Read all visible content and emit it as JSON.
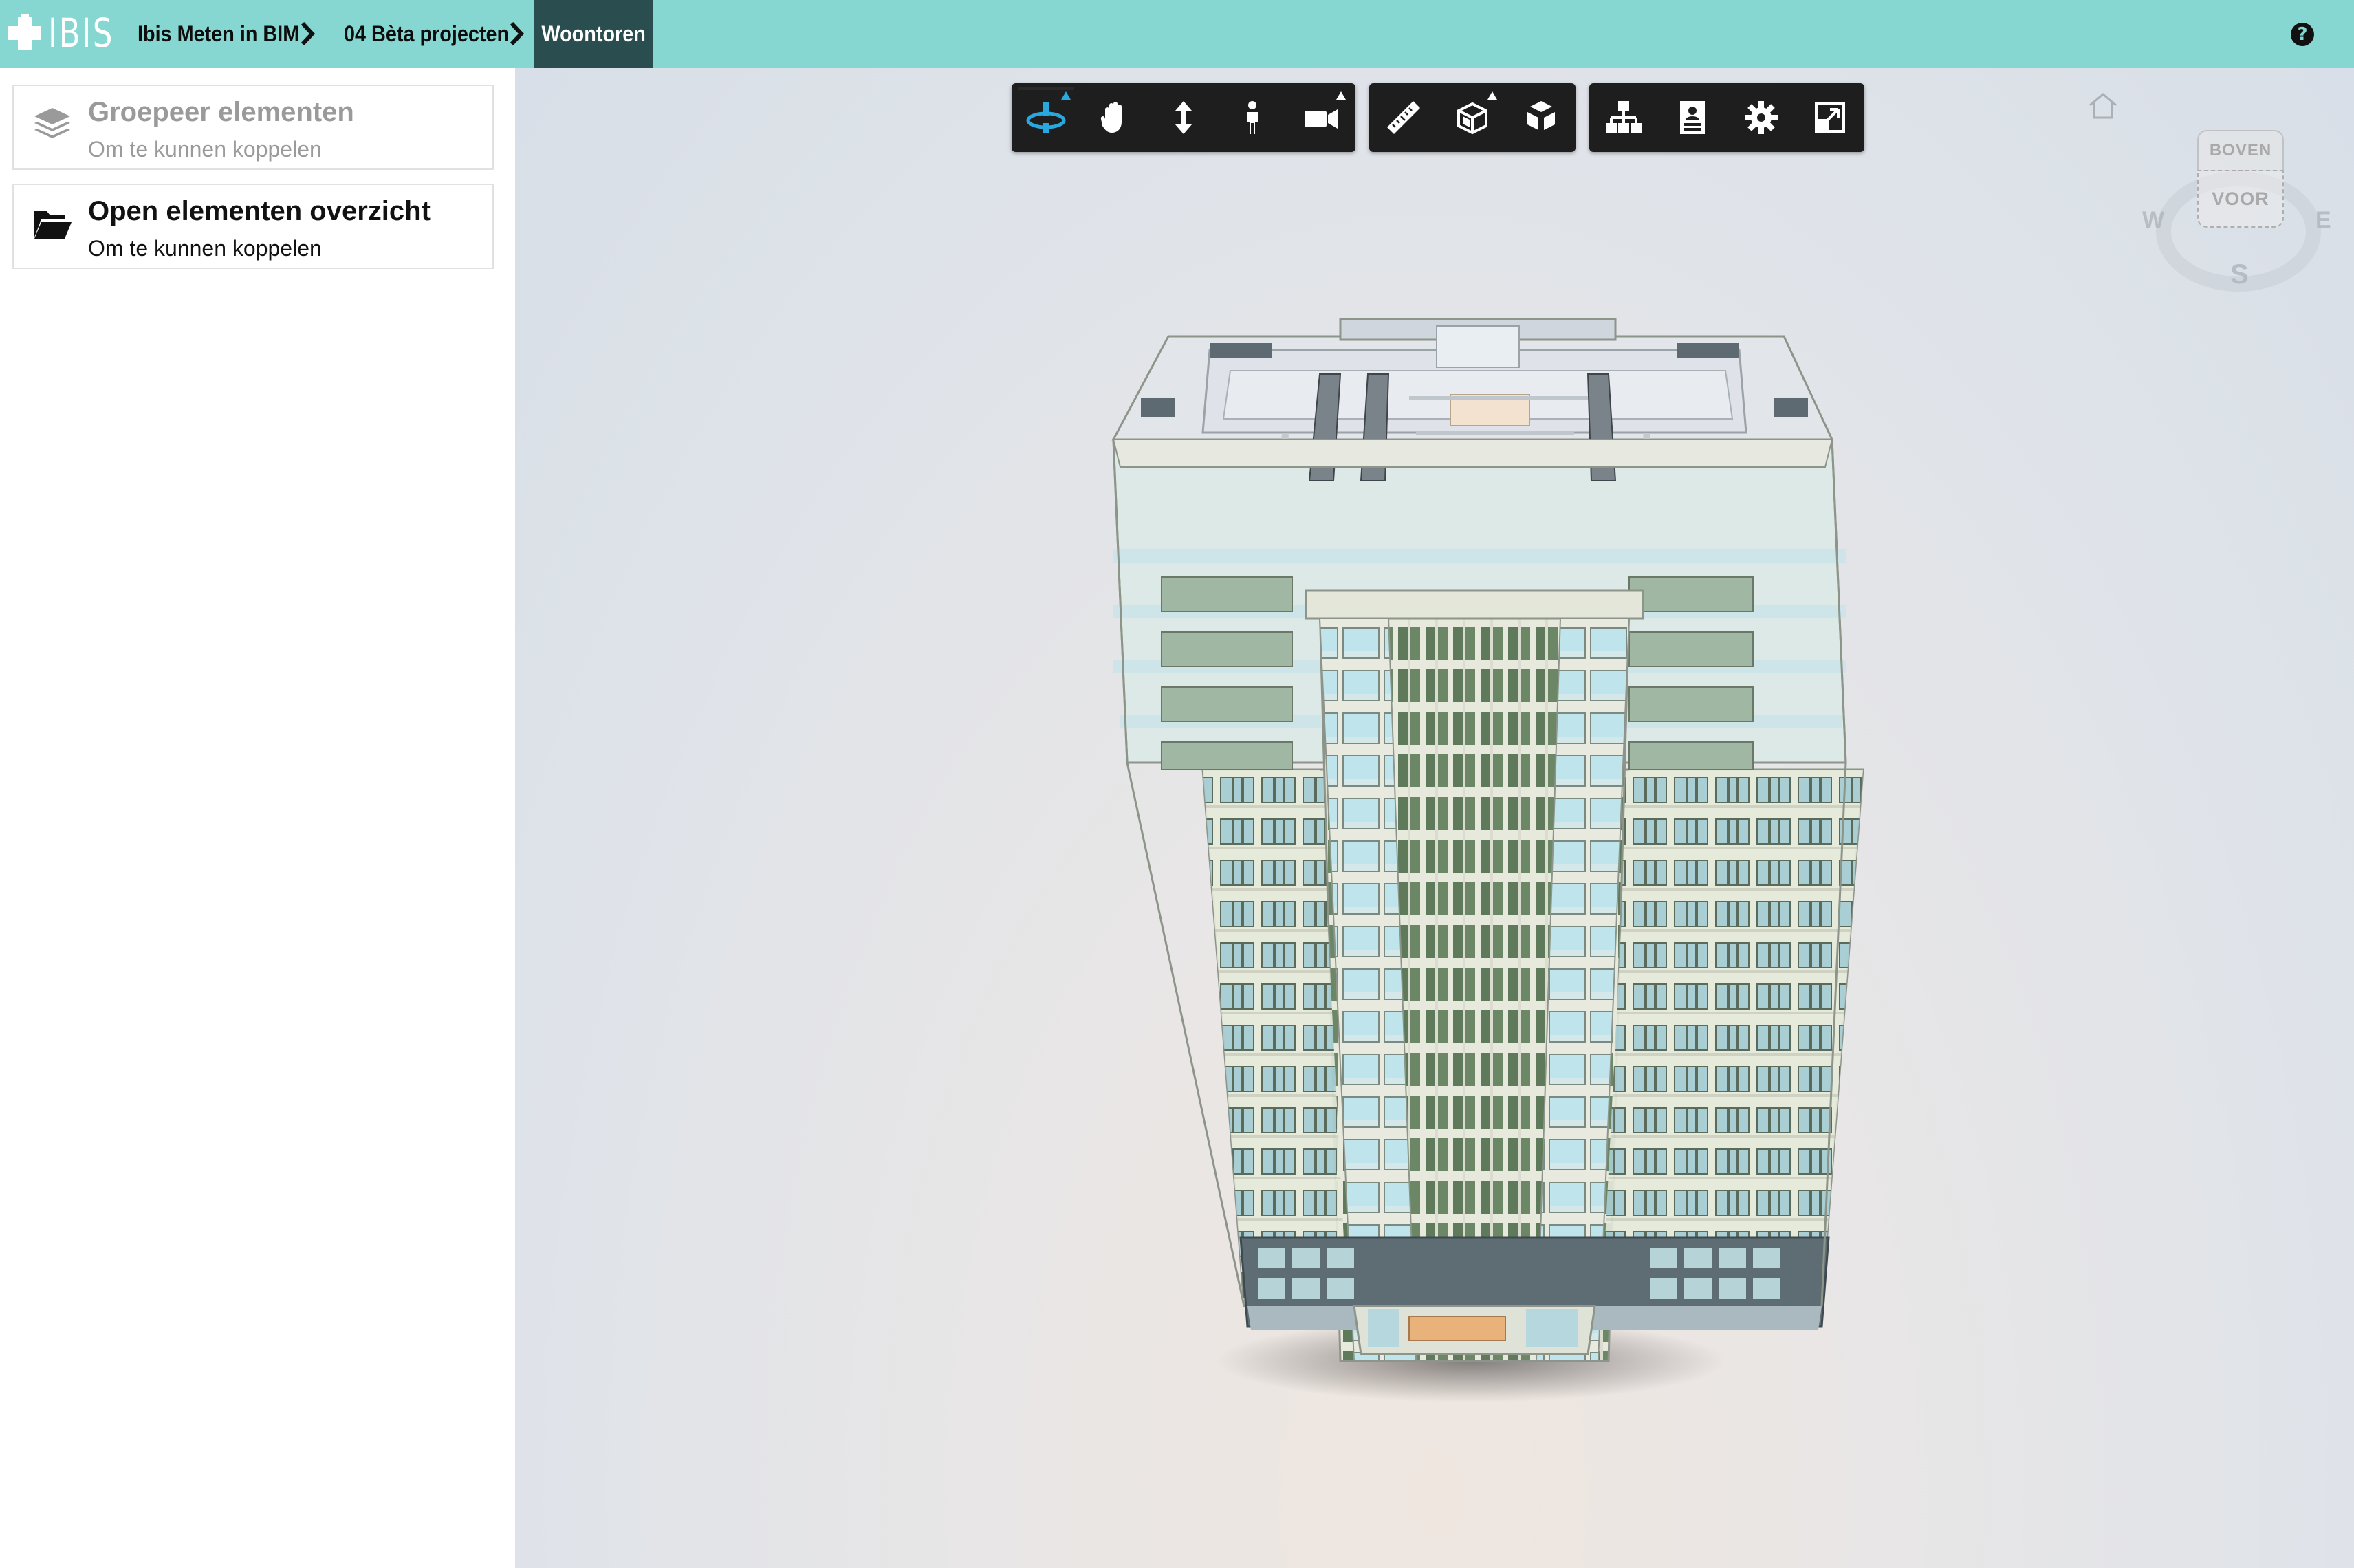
{
  "app": {
    "logo_text": "IBIS"
  },
  "breadcrumb": {
    "items": [
      {
        "label": "Ibis Meten in BIM"
      },
      {
        "label": "04 Bèta projecten"
      }
    ],
    "current": "Woontoren"
  },
  "help": {
    "icon": "question-circle-icon",
    "symbol": "?"
  },
  "sidebar": {
    "cards": [
      {
        "title": "Groepeer elementen",
        "subtitle": "Om te kunnen koppelen",
        "icon": "layers-icon",
        "enabled": false
      },
      {
        "title": "Open elementen overzicht",
        "subtitle": "Om te kunnen koppelen",
        "icon": "folder-open-icon",
        "enabled": true
      }
    ]
  },
  "toolbar": {
    "groups": [
      [
        "orbit-icon",
        "pan-icon",
        "zoom-icon",
        "first-person-icon",
        "camera-icon"
      ],
      [
        "measure-icon",
        "section-box-icon",
        "explode-icon"
      ],
      [
        "model-browser-icon",
        "properties-icon",
        "settings-icon",
        "fullscreen-icon"
      ]
    ],
    "active_tool": "orbit-icon",
    "accent_color": "#29a8e0"
  },
  "navcube": {
    "top": "BOVEN",
    "front": "VOOR",
    "compass": {
      "west": "W",
      "east": "E",
      "south": "S"
    }
  },
  "colors": {
    "topbar": "#86d6d1",
    "active_crumb": "#2a4d50"
  }
}
